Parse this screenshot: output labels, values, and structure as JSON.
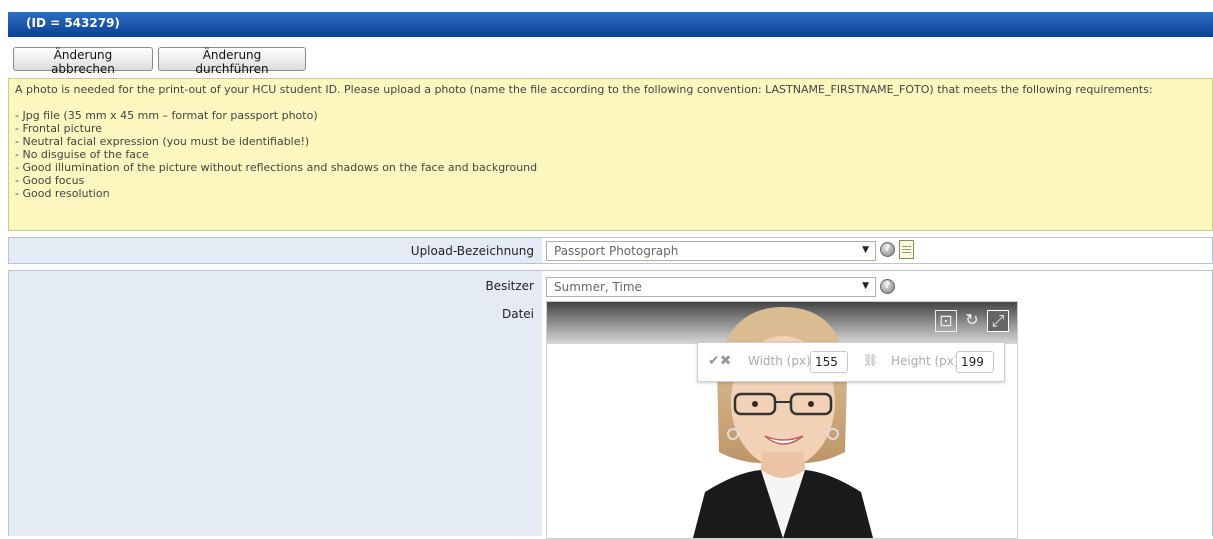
{
  "header": {
    "title": "(ID = 543279)"
  },
  "toolbar": {
    "cancel_label": "Änderung abbrechen",
    "apply_label": "Änderung durchführen"
  },
  "info": {
    "intro": "A photo is needed for the print-out of your HCU student ID. Please upload a photo (name the file according to the following convention: LASTNAME_FIRSTNAME_FOTO) that meets the following requirements:",
    "requirements": [
      "- Jpg file (35 mm x 45 mm – format for passport photo)",
      "- Frontal picture",
      "- Neutral facial expression (you must be identifiable!)",
      "- No disguise of the face",
      "- Good illumination of the picture without reflections and shadows on the face and background",
      "- Good focus",
      "- Good resolution"
    ]
  },
  "form": {
    "upload_label": "Upload-Bezeichnung",
    "upload_value": "Passport Photograph",
    "owner_label": "Besitzer",
    "owner_value": "Summer, Time",
    "file_label": "Datei"
  },
  "image_editor": {
    "tools": [
      "crop-icon",
      "rotate-icon",
      "resize-icon"
    ],
    "width_label": "Width (px)",
    "width_value": "155",
    "height_label": "Height (px)",
    "height_value": "199"
  },
  "colors": {
    "header_blue": "#0a3f98",
    "info_bg": "#fbf7bf",
    "label_bg": "#e5ebf4"
  }
}
